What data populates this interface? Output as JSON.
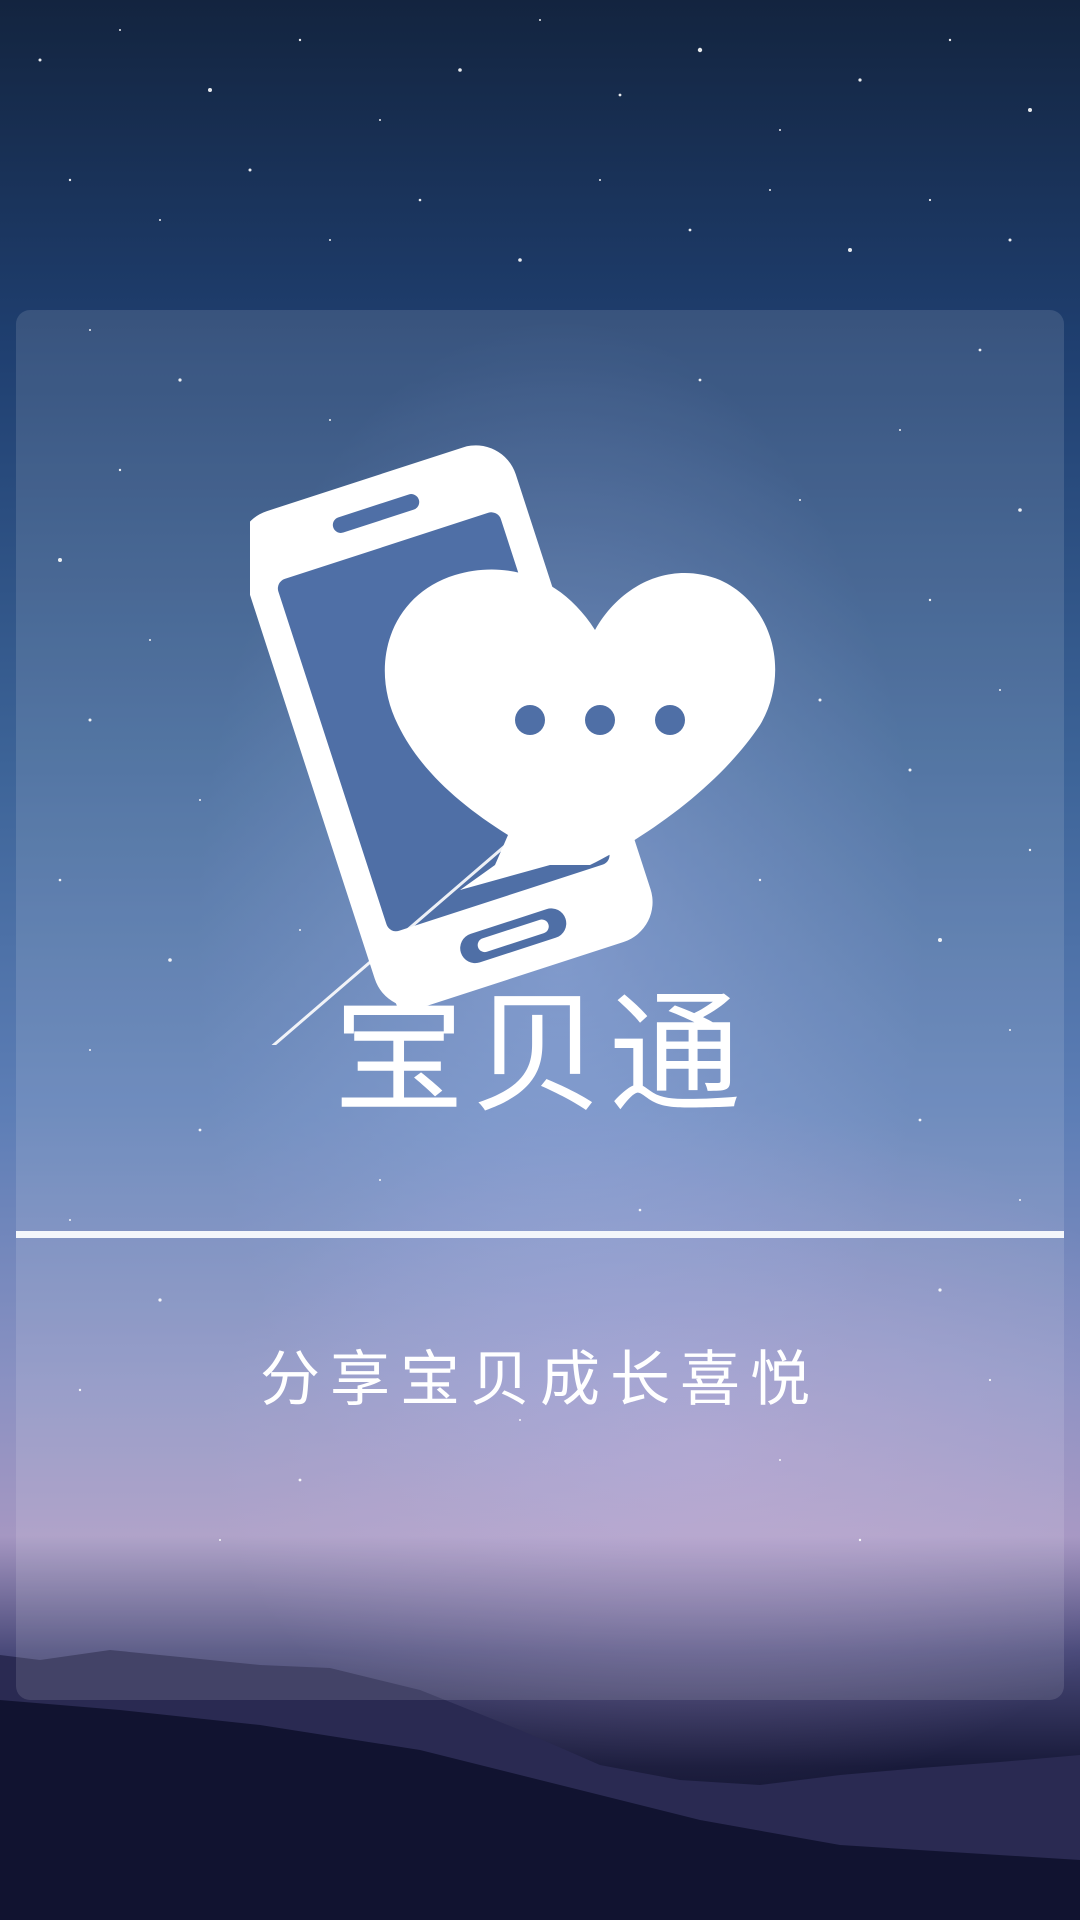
{
  "app": {
    "name": "宝贝通",
    "tagline": "分享宝贝成长喜悦"
  },
  "icons": {
    "logo": "phone-heart-chat-icon"
  },
  "colors": {
    "text": "#ffffff",
    "divider": "#f3f6fb",
    "sky_top": "#13243f",
    "sky_mid": "#5d7eb6",
    "horizon": "#a597c2",
    "ground": "#0c0e24"
  }
}
